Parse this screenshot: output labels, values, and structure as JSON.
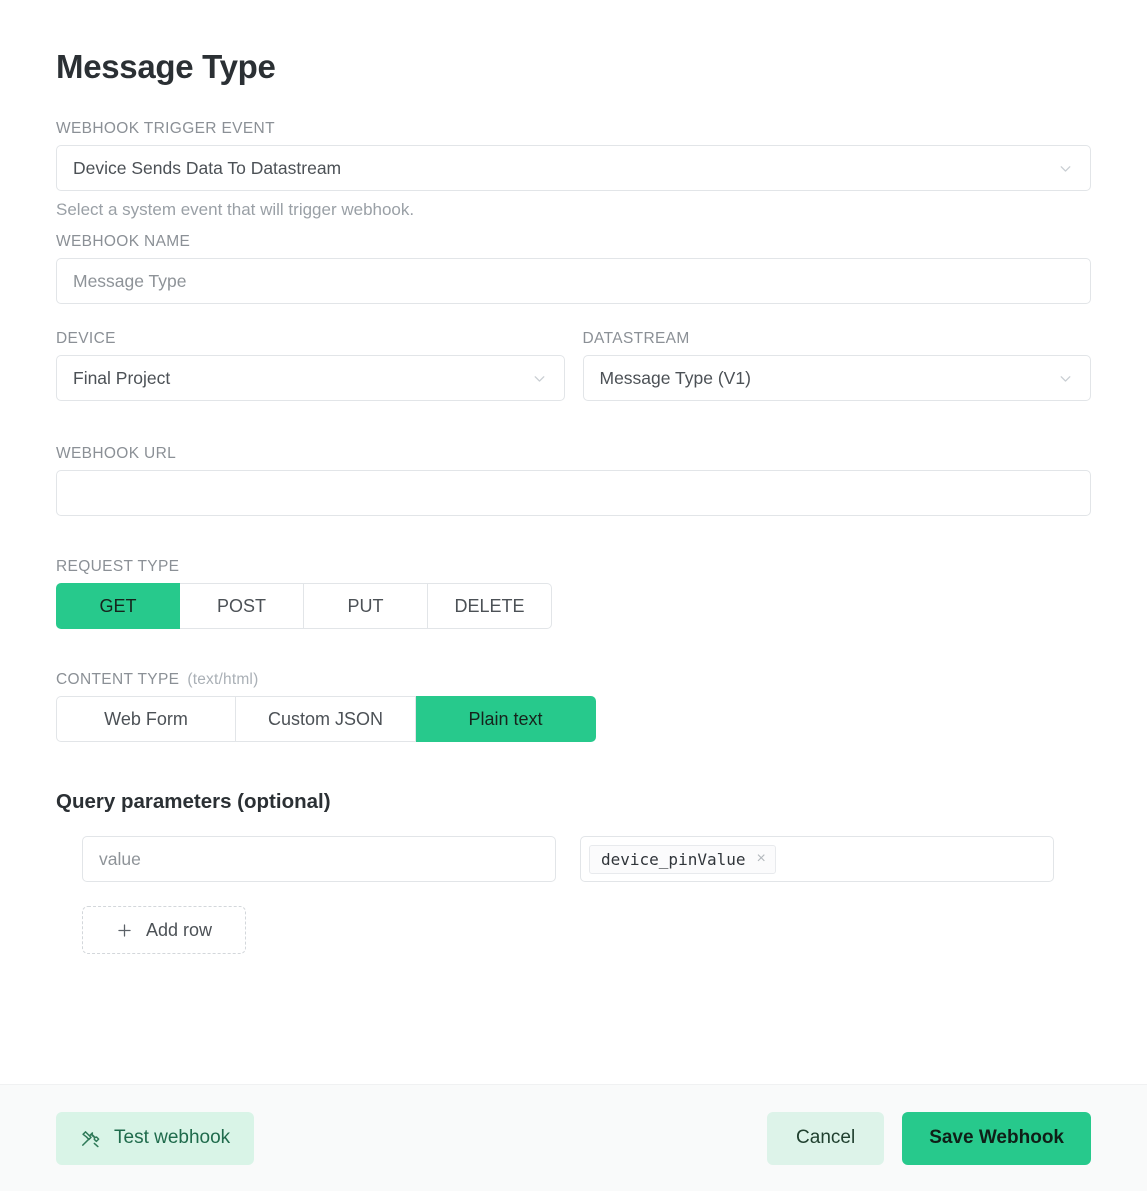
{
  "page": {
    "title": "Message Type"
  },
  "trigger": {
    "label": "WEBHOOK TRIGGER EVENT",
    "value": "Device Sends Data To Datastream",
    "helper": "Select a system event that will trigger webhook."
  },
  "webhook_name": {
    "label": "WEBHOOK NAME",
    "value": "Message Type"
  },
  "device": {
    "label": "DEVICE",
    "value": "Final Project"
  },
  "datastream": {
    "label": "DATASTREAM",
    "value": "Message Type (V1)"
  },
  "webhook_url": {
    "label": "WEBHOOK URL",
    "value": ""
  },
  "request_type": {
    "label": "REQUEST TYPE",
    "options": [
      "GET",
      "POST",
      "PUT",
      "DELETE"
    ],
    "selected": "GET"
  },
  "content_type": {
    "label": "CONTENT TYPE",
    "note": "(text/html)",
    "options": [
      "Web Form",
      "Custom JSON",
      "Plain text"
    ],
    "selected": "Plain text"
  },
  "query_parameters": {
    "title": "Query parameters (optional)",
    "rows": [
      {
        "key": "value",
        "token": "device_pinValue",
        "remove": "×"
      }
    ],
    "add_row_label": "Add row"
  },
  "footer": {
    "test_label": "Test webhook",
    "cancel_label": "Cancel",
    "save_label": "Save Webhook"
  },
  "colors": {
    "accent_green": "#27c98c",
    "mint": "#d9f4e7",
    "footer_bg": "#f9fafa",
    "border": "#e2e5e8"
  }
}
